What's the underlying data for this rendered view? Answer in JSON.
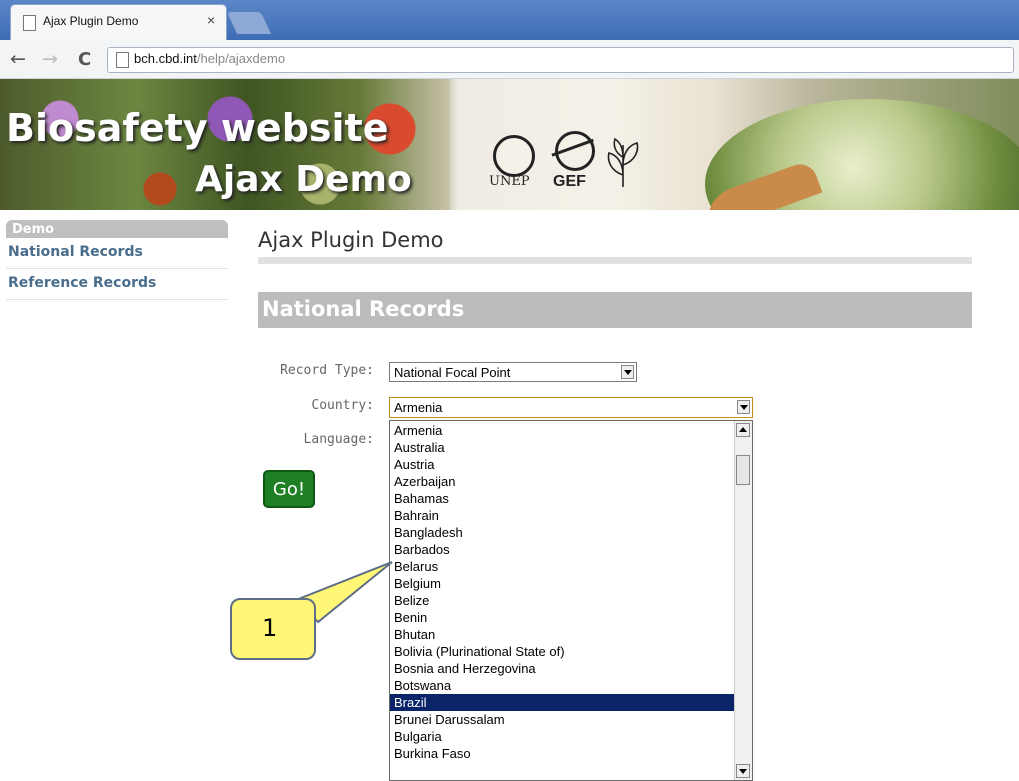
{
  "browser": {
    "tab_title": "Ajax Plugin Demo",
    "tab_close": "×",
    "url_host": "bch.cbd.int",
    "url_path": "/help/ajaxdemo",
    "back_icon": "←",
    "forward_icon": "→",
    "reload_icon": "C"
  },
  "banner": {
    "line1": "Biosafety website",
    "line2": "Ajax Demo",
    "unep": "UNEP",
    "gef": "GEF"
  },
  "sidebar": {
    "header": "Demo",
    "items": [
      {
        "label": "National Records"
      },
      {
        "label": "Reference Records"
      }
    ]
  },
  "main": {
    "page_title": "Ajax Plugin Demo",
    "section_title": "National Records",
    "form": {
      "record_type_label": "Record Type:",
      "record_type_value": "National Focal Point",
      "country_label": "Country:",
      "country_value": "Armenia",
      "language_label": "Language:",
      "go_label": "Go!"
    }
  },
  "dropdown": {
    "selected": "Brazil",
    "options": [
      "Armenia",
      "Australia",
      "Austria",
      "Azerbaijan",
      "Bahamas",
      "Bahrain",
      "Bangladesh",
      "Barbados",
      "Belarus",
      "Belgium",
      "Belize",
      "Benin",
      "Bhutan",
      "Bolivia (Plurinational State of)",
      "Bosnia and Herzegovina",
      "Botswana",
      "Brazil",
      "Brunei Darussalam",
      "Bulgaria",
      "Burkina Faso"
    ]
  },
  "callout": {
    "number": "1"
  },
  "colors": {
    "tabbar": "#3e6cb4",
    "selection": "#0a246a",
    "go_button": "#1e7f24",
    "callout_fill": "#fff775",
    "sidebar_link": "#4a6d8c"
  }
}
